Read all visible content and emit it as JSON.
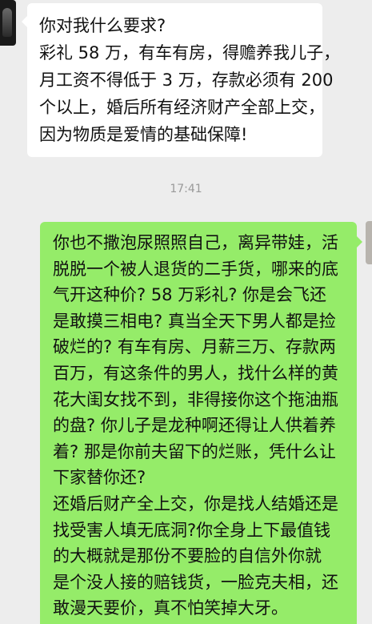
{
  "chat": {
    "incoming": {
      "lines": [
        "你对我什么要求?",
        "彩礼 58 万，有车有房，得赡养我儿子，",
        "月工资不得低于 3 万，存款必须有 200",
        "个以上，婚后所有经济财产全部上交，",
        "因为物质是爱情的基础保障!"
      ]
    },
    "timestamp": "17:41",
    "outgoing": {
      "lines": [
        "你也不撒泡尿照照自己，离异带娃，活",
        "脱脱一个被人退货的二手货，哪来的底",
        "气开这种价? 58 万彩礼? 你是会飞还",
        "是敢摸三相电? 真当全天下男人都是捡",
        "破烂的? 有车有房、月薪三万、存款两",
        "百万，有这条件的男人，找什么样的黄",
        "花大闺女找不到，非得接你这个拖油瓶",
        "的盘? 你儿子是龙种啊还得让人供着养",
        "着? 那是你前夫留下的烂账，凭什么让",
        "下家替你还?",
        "还婚后财产全上交，你是找人结婚还是",
        "找受害人填无底洞?你全身上下最值钱",
        "的大概就是那份不要脸的自信外你就",
        "是个没人接的赔钱货，一脸克夫相，还",
        "敢漫天要价，真不怕笑掉大牙。"
      ]
    }
  }
}
